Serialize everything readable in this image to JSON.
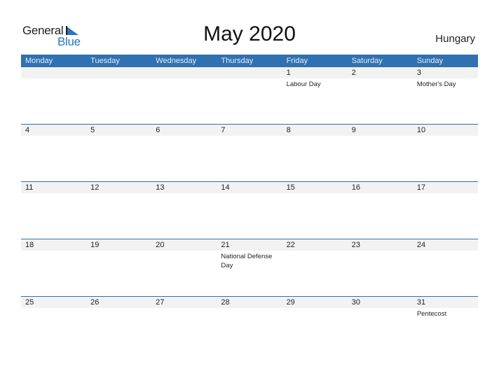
{
  "logo": {
    "word1": "General",
    "word2": "Blue",
    "accent": "#2a75c1"
  },
  "header": {
    "title": "May 2020",
    "country": "Hungary"
  },
  "colors": {
    "header_bg": "#2f71b1",
    "day_band": "#f2f2f2"
  },
  "weekdays": [
    "Monday",
    "Tuesday",
    "Wednesday",
    "Thursday",
    "Friday",
    "Saturday",
    "Sunday"
  ],
  "weeks": [
    [
      {
        "day": "",
        "event": ""
      },
      {
        "day": "",
        "event": ""
      },
      {
        "day": "",
        "event": ""
      },
      {
        "day": "",
        "event": ""
      },
      {
        "day": "1",
        "event": "Labour Day"
      },
      {
        "day": "2",
        "event": ""
      },
      {
        "day": "3",
        "event": "Mother's Day"
      }
    ],
    [
      {
        "day": "4",
        "event": ""
      },
      {
        "day": "5",
        "event": ""
      },
      {
        "day": "6",
        "event": ""
      },
      {
        "day": "7",
        "event": ""
      },
      {
        "day": "8",
        "event": ""
      },
      {
        "day": "9",
        "event": ""
      },
      {
        "day": "10",
        "event": ""
      }
    ],
    [
      {
        "day": "11",
        "event": ""
      },
      {
        "day": "12",
        "event": ""
      },
      {
        "day": "13",
        "event": ""
      },
      {
        "day": "14",
        "event": ""
      },
      {
        "day": "15",
        "event": ""
      },
      {
        "day": "16",
        "event": ""
      },
      {
        "day": "17",
        "event": ""
      }
    ],
    [
      {
        "day": "18",
        "event": ""
      },
      {
        "day": "19",
        "event": ""
      },
      {
        "day": "20",
        "event": ""
      },
      {
        "day": "21",
        "event": "National Defense Day"
      },
      {
        "day": "22",
        "event": ""
      },
      {
        "day": "23",
        "event": ""
      },
      {
        "day": "24",
        "event": ""
      }
    ],
    [
      {
        "day": "25",
        "event": ""
      },
      {
        "day": "26",
        "event": ""
      },
      {
        "day": "27",
        "event": ""
      },
      {
        "day": "28",
        "event": ""
      },
      {
        "day": "29",
        "event": ""
      },
      {
        "day": "30",
        "event": ""
      },
      {
        "day": "31",
        "event": "Pentecost"
      }
    ]
  ]
}
